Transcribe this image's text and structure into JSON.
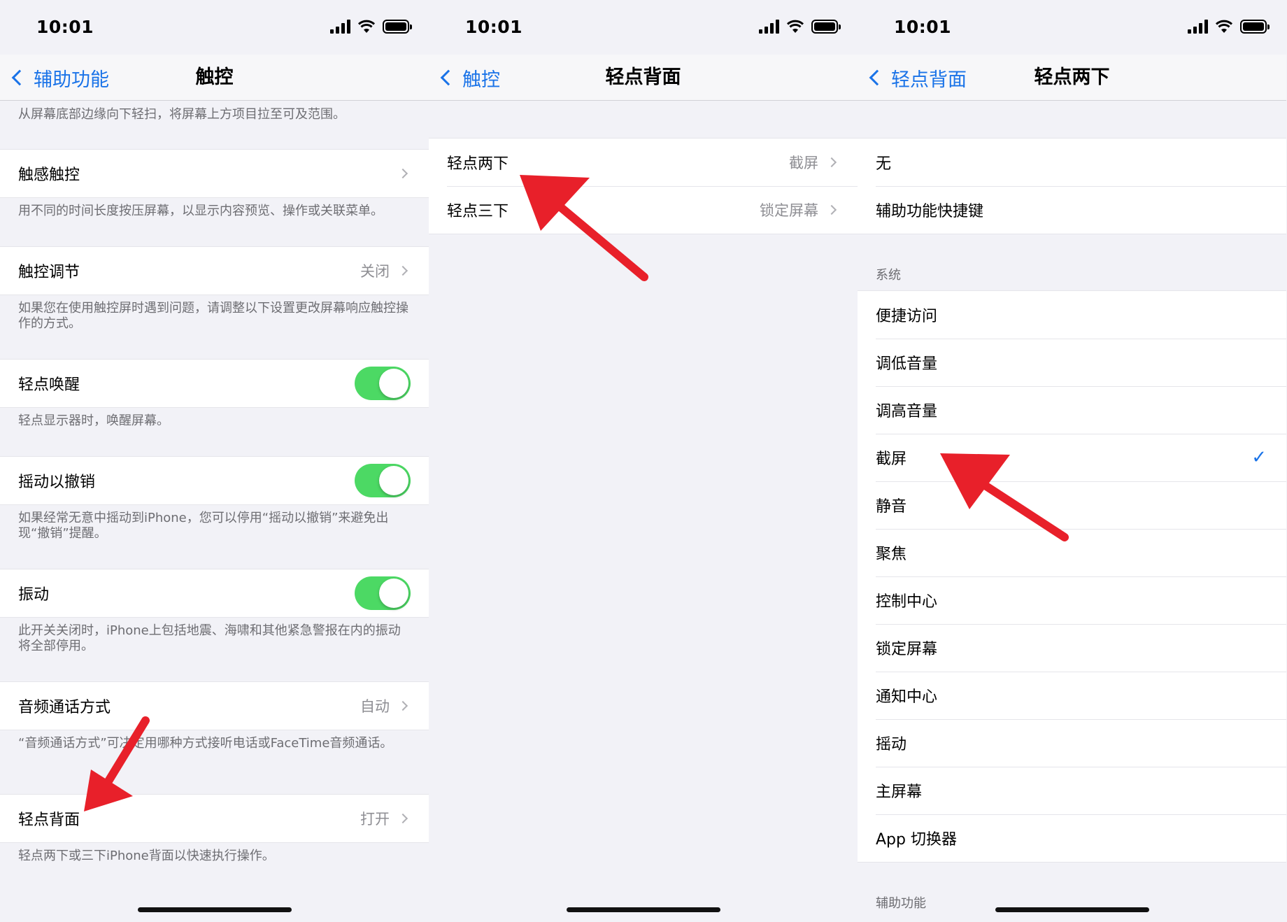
{
  "status_time": "10:01",
  "panels": {
    "touch": {
      "back_label": "辅助功能",
      "title": "触控",
      "top_note": "从屏幕底部边缘向下轻扫，将屏幕上方项目拉至可及范围。",
      "haptic": {
        "label": "触感触控",
        "note": "用不同的时间长度按压屏幕，以显示内容预览、操作或关联菜单。"
      },
      "touch_accommodations": {
        "label": "触控调节",
        "value": "关闭",
        "note": "如果您在使用触控屏时遇到问题，请调整以下设置更改屏幕响应触控操作的方式。"
      },
      "tap_to_wake": {
        "label": "轻点唤醒",
        "on": true,
        "note": "轻点显示器时，唤醒屏幕。"
      },
      "shake_to_undo": {
        "label": "摇动以撤销",
        "on": true,
        "note": "如果经常无意中摇动到iPhone，您可以停用“摇动以撤销”来避免出现“撤销”提醒。"
      },
      "vibration": {
        "label": "振动",
        "on": true,
        "note": "此开关关闭时，iPhone上包括地震、海啸和其他紧急警报在内的振动将全部停用。"
      },
      "call_audio": {
        "label": "音频通话方式",
        "value": "自动",
        "note": "“音频通话方式”可决定用哪种方式接听电话或FaceTime音频通话。"
      },
      "back_tap": {
        "label": "轻点背面",
        "value": "打开",
        "note": "轻点两下或三下iPhone背面以快速执行操作。"
      }
    },
    "back_tap": {
      "back_label": "触控",
      "title": "轻点背面",
      "double_tap": {
        "label": "轻点两下",
        "value": "截屏"
      },
      "triple_tap": {
        "label": "轻点三下",
        "value": "锁定屏幕"
      }
    },
    "double_tap": {
      "back_label": "轻点背面",
      "title": "轻点两下",
      "top_options": [
        "无",
        "辅助功能快捷键"
      ],
      "system_header": "系统",
      "system_options": [
        "便捷访问",
        "调低音量",
        "调高音量",
        "截屏",
        "静音",
        "聚焦",
        "控制中心",
        "锁定屏幕",
        "通知中心",
        "摇动",
        "主屏幕",
        "App 切换器"
      ],
      "selected_option": "截屏",
      "accessibility_header": "辅助功能"
    }
  },
  "colors": {
    "accent": "#1a73e8",
    "toggle_on": "#4cd964",
    "annotation_arrow": "#e8202a"
  }
}
